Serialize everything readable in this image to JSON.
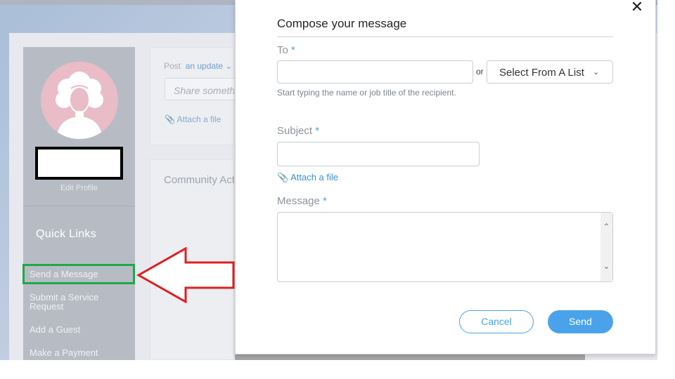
{
  "sidebar": {
    "edit_profile": "Edit Profile",
    "quick_links_title": "Quick Links",
    "items": [
      {
        "label": "Send a Message"
      },
      {
        "label": "Submit a Service Request"
      },
      {
        "label": "Add a Guest"
      },
      {
        "label": "Make a Payment"
      }
    ]
  },
  "feed": {
    "post_prefix": "Post",
    "post_type": "an update",
    "share_placeholder": "Share something...",
    "attach_label": "Attach a file",
    "community_title": "Community Activity"
  },
  "modal": {
    "title": "Compose your message",
    "close_icon": "close-icon",
    "to_label": "To",
    "required_marker": "*",
    "or_text": "or",
    "select_label": "Select From A List",
    "to_hint": "Start typing the name or job title of the recipient.",
    "subject_label": "Subject",
    "attach_label": "Attach a file",
    "message_label": "Message",
    "cancel_label": "Cancel",
    "send_label": "Send"
  },
  "colors": {
    "accent": "#4aa3ea",
    "highlight_box": "#1fa84a",
    "arrow": "#e02020"
  }
}
